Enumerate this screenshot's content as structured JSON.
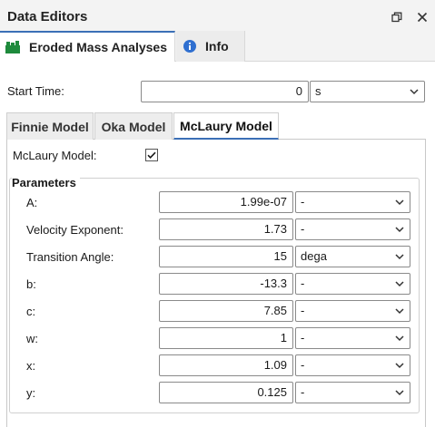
{
  "header": {
    "title": "Data Editors"
  },
  "top_tabs": [
    {
      "label": "Eroded Mass Analyses",
      "icon": "stacked-blocks-icon",
      "active": true
    },
    {
      "label": "Info",
      "icon": "info-icon",
      "active": false
    }
  ],
  "start_time": {
    "label": "Start Time:",
    "value": "0",
    "unit": "s"
  },
  "model_tabs": [
    {
      "label": "Finnie Model",
      "active": false
    },
    {
      "label": "Oka Model",
      "active": false
    },
    {
      "label": "McLaury Model",
      "active": true
    }
  ],
  "mclaury": {
    "label": "McLaury Model:",
    "checked": true
  },
  "parameters": {
    "title": "Parameters",
    "rows": [
      {
        "label": "A:",
        "value": "1.99e-07",
        "unit": "-"
      },
      {
        "label": "Velocity Exponent:",
        "value": "1.73",
        "unit": "-"
      },
      {
        "label": "Transition Angle:",
        "value": "15",
        "unit": "dega"
      },
      {
        "label": "b:",
        "value": "-13.3",
        "unit": "-"
      },
      {
        "label": "c:",
        "value": "7.85",
        "unit": "-"
      },
      {
        "label": "w:",
        "value": "1",
        "unit": "-"
      },
      {
        "label": "x:",
        "value": "1.09",
        "unit": "-"
      },
      {
        "label": "y:",
        "value": "0.125",
        "unit": "-"
      }
    ]
  },
  "colors": {
    "accent": "#3b6fb6",
    "brand_green": "#1e8a3c"
  }
}
